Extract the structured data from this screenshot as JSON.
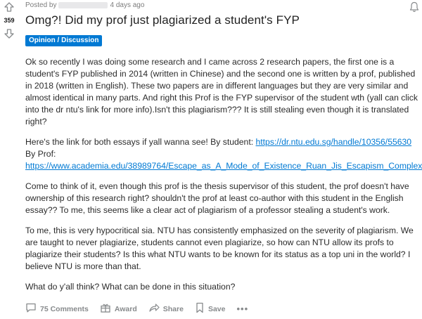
{
  "post": {
    "score": "359",
    "posted_by": "Posted by",
    "time_ago": "4 days ago",
    "title": "Omg?! Did my prof just plagiarized a student's FYP",
    "flair": "Opinion / Discussion",
    "paragraphs": {
      "p1": "Ok so recently I was doing some research and I came across 2 research papers, the first one is a student's FYP published in 2014 (written in Chinese) and the second one is written by a prof, published in 2018 (written in English). These two papers are in different languages but they are very similar and almost identical in many parts. And right this Prof is the FYP supervisor of the student wth (yall can click into the dr ntu's link for more info).Isn't this plagiarism??? It is still stealing even though it is translated right?",
      "p2_intro": "Here's the link for both essays if yall wanna see! By student: ",
      "student_link": "https://dr.ntu.edu.sg/handle/10356/55630",
      "by_prof": "By Prof:",
      "prof_link": "https://www.academia.edu/38989764/Escape_as_A_Mode_of_Existence_Ruan_Jis_Escapism_Complex",
      "p3": "Come to think of it, even though this prof is the thesis supervisor of this student, the prof doesn't have ownership of this research right? shouldn't the prof at least co-author with this student in the English essay?? To me, this seems like a clear act of plagiarism of a professor stealing a student's work.",
      "p4": "To me, this is very hypocritical sia. NTU has consistently emphasized on the severity of plagiarism. We are taught to never plagiarize, students cannot even plagiarize, so how can NTU allow its profs to plagiarize their students? Is this what NTU wants to be known for its status as a top uni in the world? I believe NTU is more than that.",
      "p5": "What do y'all think? What can be done in this situation?"
    }
  },
  "actions": {
    "comments": "75 Comments",
    "award": "Award",
    "share": "Share",
    "save": "Save",
    "more": "•••"
  },
  "colors": {
    "flair_bg": "#0079d3",
    "link": "#0079d3",
    "muted": "#878a8c"
  }
}
